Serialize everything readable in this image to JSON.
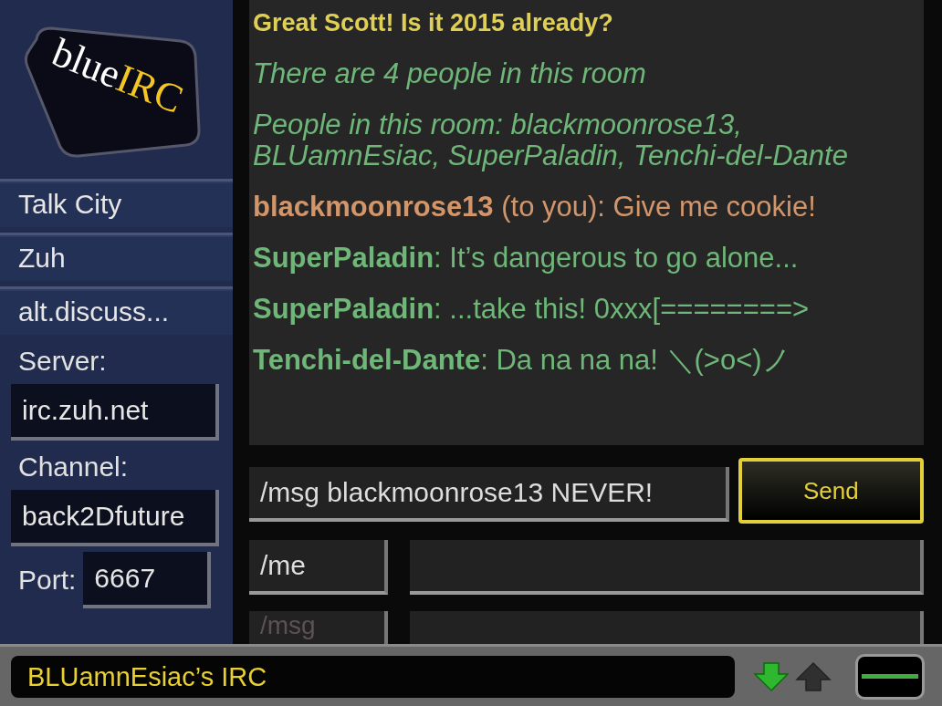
{
  "logo": {
    "word_1": "blue",
    "word_2": "IRC"
  },
  "sidebar": {
    "items": [
      {
        "label": "Talk City"
      },
      {
        "label": "Zuh"
      },
      {
        "label": "alt.discuss..."
      }
    ],
    "server": {
      "label": "Server:",
      "value": "irc.zuh.net"
    },
    "channel": {
      "label": "Channel:",
      "value": "back2Dfuture"
    },
    "port": {
      "label": "Port:",
      "value": "6667"
    }
  },
  "messages": [
    {
      "kind": "system",
      "text": "Great Scott!  Is it 2015 already?"
    },
    {
      "kind": "notice",
      "text": "There are 4 people in this room"
    },
    {
      "kind": "notice",
      "text": "People in this room: blackmoonrose13, BLUamnEsiac, SuperPaladin, Tenchi-del-Dante"
    },
    {
      "kind": "private",
      "text": "**blackmoonrose13** (to you): Give me cookie!"
    },
    {
      "kind": "chat",
      "text": "**SuperPaladin**: It’s dangerous to go alone..."
    },
    {
      "kind": "chat",
      "text": "**SuperPaladin**: ...take this! 0xxx[========>"
    },
    {
      "kind": "chat",
      "text": "**Tenchi-del-Dante**: Da na na na! ＼(>o<)ノ"
    }
  ],
  "composer": {
    "value": "/msg blackmoonrose13 NEVER!",
    "send": "Send"
  },
  "command_rows": [
    {
      "command": "/me",
      "disabled": false
    },
    {
      "command": "/msg",
      "disabled": true
    }
  ],
  "status_bar": {
    "title": "BLUamnEsiac’s IRC"
  }
}
